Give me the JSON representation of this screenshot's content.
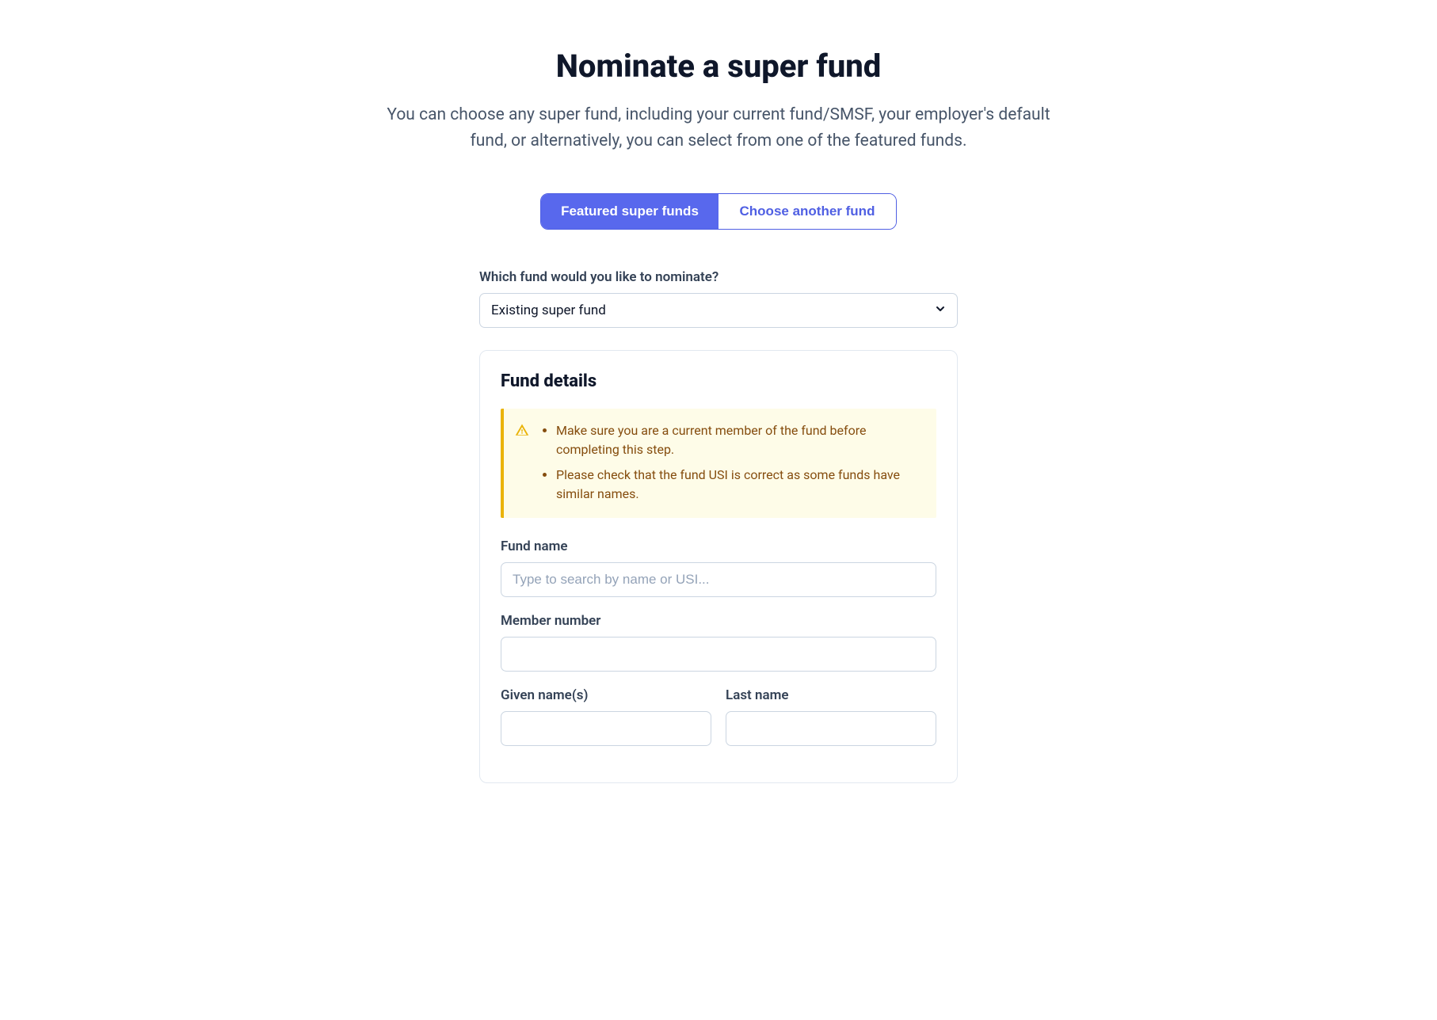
{
  "header": {
    "title": "Nominate a super fund",
    "subtitle": "You can choose any super fund, including your current fund/SMSF, your employer's default fund, or alternatively, you can select from one of the featured funds."
  },
  "tabs": {
    "featured": "Featured super funds",
    "another": "Choose another fund"
  },
  "nominate": {
    "label": "Which fund would you like to nominate?",
    "selected": "Existing super fund"
  },
  "card": {
    "title": "Fund details"
  },
  "alert": {
    "items": [
      "Make sure you are a current member of the fund before completing this step.",
      "Please check that the fund USI is correct as some funds have similar names."
    ]
  },
  "fields": {
    "fund_name": {
      "label": "Fund name",
      "placeholder": "Type to search by name or USI..."
    },
    "member_number": {
      "label": "Member number"
    },
    "given_names": {
      "label": "Given name(s)"
    },
    "last_name": {
      "label": "Last name"
    }
  }
}
